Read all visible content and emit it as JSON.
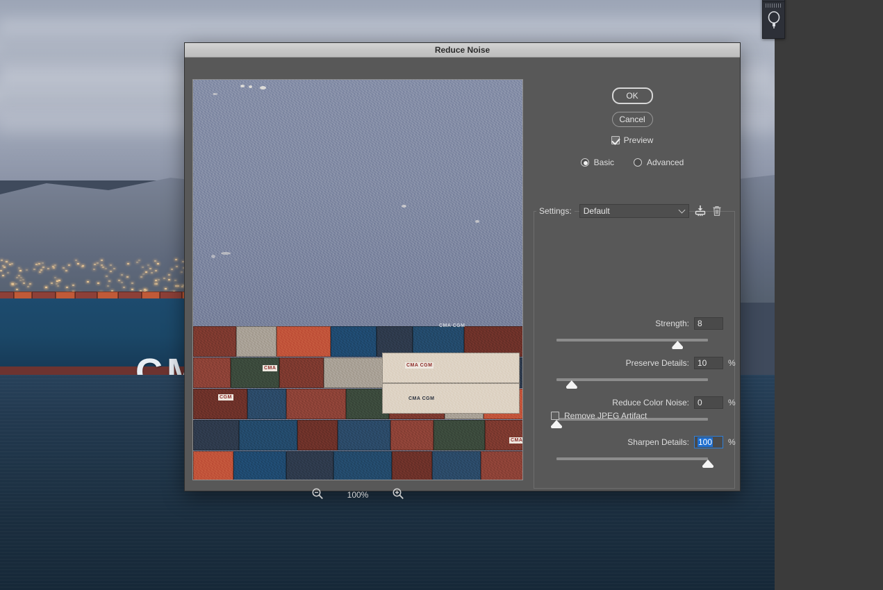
{
  "window": {
    "title": "Reduce Noise"
  },
  "toolstrip": {
    "grip_name": "drag-grip",
    "bulb_label": "lasso-tool"
  },
  "buttons": {
    "ok": "OK",
    "cancel": "Cancel"
  },
  "preview_toggle": {
    "label": "Preview",
    "checked": true
  },
  "mode": {
    "options": [
      {
        "label": "Basic",
        "selected": true
      },
      {
        "label": "Advanced",
        "selected": false
      }
    ],
    "basic_label": "Basic",
    "advanced_label": "Advanced"
  },
  "settings": {
    "label": "Settings:",
    "value": "Default",
    "options": [
      "Default"
    ],
    "save_icon": "save-settings-icon",
    "delete_icon": "trash-icon"
  },
  "sliders": [
    {
      "label": "Strength:",
      "value": "8",
      "unit": "",
      "min": 0,
      "max": 10,
      "percent": 80,
      "focused": false
    },
    {
      "label": "Preserve Details:",
      "value": "10",
      "unit": "%",
      "min": 0,
      "max": 100,
      "percent": 10,
      "focused": false
    },
    {
      "label": "Reduce Color Noise:",
      "value": "0",
      "unit": "%",
      "min": 0,
      "max": 100,
      "percent": 0,
      "focused": false
    },
    {
      "label": "Sharpen Details:",
      "value": "100",
      "unit": "%",
      "min": 0,
      "max": 100,
      "percent": 100,
      "focused": true
    }
  ],
  "jpeg_artifact": {
    "label": "Remove JPEG Artifact",
    "checked": false
  },
  "zoom": {
    "level": "100%",
    "zoom_out_icon": "zoom-out-icon",
    "zoom_in_icon": "zoom-in-icon"
  },
  "preview_image": {
    "alt": "container-ship-noise-preview",
    "container_labels": [
      "CMA CGM",
      "CMA CGM",
      "CMA CGM",
      "CMA",
      "CMA",
      "CGM"
    ]
  },
  "background_image": {
    "alt": "container-ship-at-sea",
    "hull_text": "CMA"
  },
  "colors": {
    "dialog_bg": "#585858",
    "titlebar": "#c6c6c6",
    "accent_selection": "#1f6fd0",
    "text": "#dedede",
    "track": "#8c8c8c",
    "thumb": "#f4f4f4"
  }
}
